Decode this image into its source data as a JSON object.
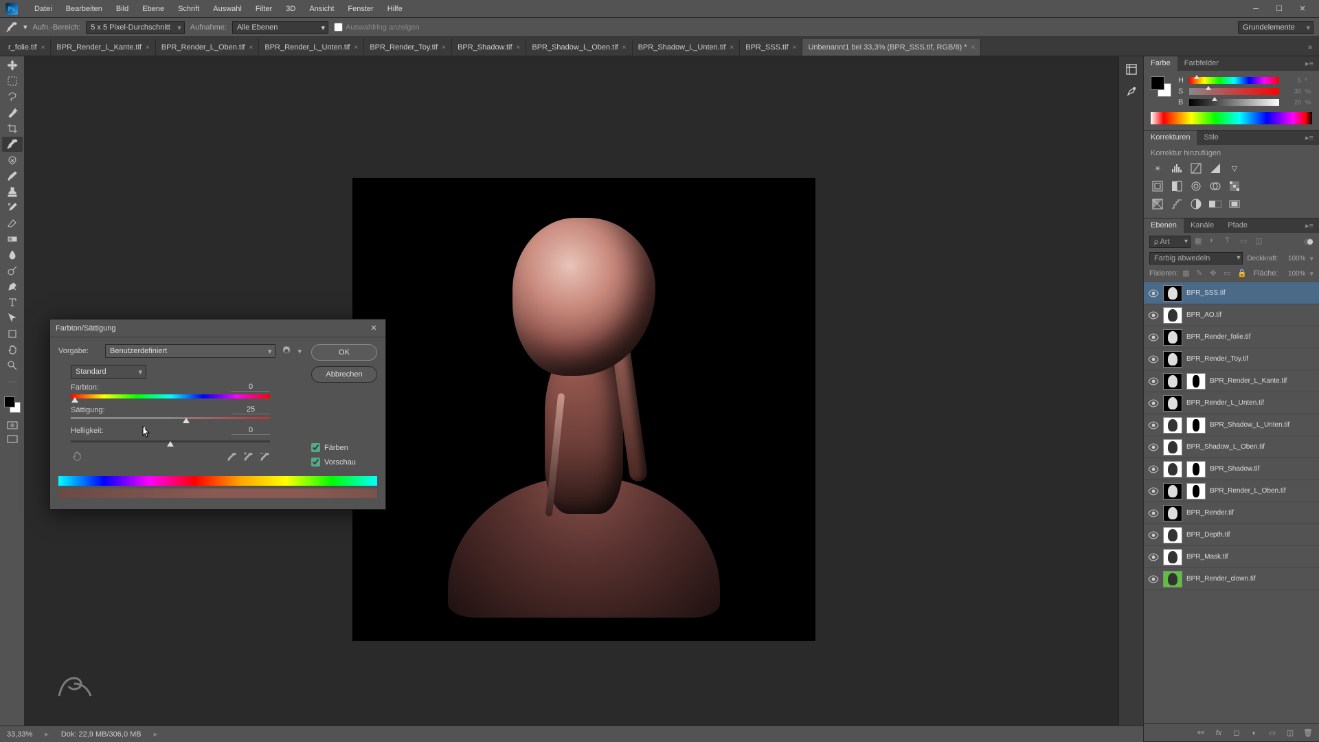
{
  "menu": [
    "Datei",
    "Bearbeiten",
    "Bild",
    "Ebene",
    "Schrift",
    "Auswahl",
    "Filter",
    "3D",
    "Ansicht",
    "Fenster",
    "Hilfe"
  ],
  "options": {
    "aufn_label": "Aufn.-Bereich:",
    "aufn_value": "5 x 5 Pixel-Durchschnitt",
    "aufnahme_label": "Aufnahme:",
    "aufnahme_value": "Alle Ebenen",
    "show_rings": "Auswahlring anzeigen",
    "right_menu": "Grundelemente"
  },
  "tabs": [
    {
      "label": "r_folie.tif"
    },
    {
      "label": "BPR_Render_L_Kante.tif"
    },
    {
      "label": "BPR_Render_L_Oben.tif"
    },
    {
      "label": "BPR_Render_L_Unten.tif"
    },
    {
      "label": "BPR_Render_Toy.tif"
    },
    {
      "label": "BPR_Shadow.tif"
    },
    {
      "label": "BPR_Shadow_L_Oben.tif"
    },
    {
      "label": "BPR_Shadow_L_Unten.tif"
    },
    {
      "label": "BPR_SSS.tif"
    },
    {
      "label": "Unbenannt1 bei 33,3% (BPR_SSS.tif, RGB/8) *",
      "active": true
    }
  ],
  "status": {
    "zoom": "33,33%",
    "doc": "Dok: 22,9 MB/306,0 MB"
  },
  "panel_color": {
    "tabs": [
      "Farbe",
      "Farbfelder"
    ],
    "rows": [
      {
        "l": "H",
        "v": "5",
        "u": "º"
      },
      {
        "l": "S",
        "v": "30",
        "u": "%"
      },
      {
        "l": "B",
        "v": "20",
        "u": "%"
      }
    ]
  },
  "panel_adj": {
    "tabs": [
      "Korrekturen",
      "Stile"
    ],
    "hint": "Korrektur hinzufügen"
  },
  "panel_layers": {
    "tabs": [
      "Ebenen",
      "Kanäle",
      "Pfade"
    ],
    "filter": "Art",
    "blend": "Farbig abwedeln",
    "opacity_label": "Deckkraft:",
    "opacity": "100%",
    "lock_label": "Fixieren:",
    "fill_label": "Fläche:",
    "fill": "100%",
    "layers": [
      {
        "name": "BPR_SSS.tif",
        "sel": true
      },
      {
        "name": "BPR_AO.tif",
        "thumb": "white"
      },
      {
        "name": "BPR_Render_folie.tif"
      },
      {
        "name": "BPR_Render_Toy.tif"
      },
      {
        "name": "BPR_Render_L_Kante.tif",
        "mask": true
      },
      {
        "name": "BPR_Render_L_Unten.tif"
      },
      {
        "name": "BPR_Shadow_L_Unten.tif",
        "mask": true,
        "thumb": "white"
      },
      {
        "name": "BPR_Shadow_L_Oben.tif",
        "mask": false,
        "thumb": "white"
      },
      {
        "name": "BPR_Shadow.tif",
        "mask": true,
        "thumb": "white"
      },
      {
        "name": "BPR_Render_L_Oben.tif",
        "mask": true
      },
      {
        "name": "BPR_Render.tif"
      },
      {
        "name": "BPR_Depth.tif",
        "thumb": "white"
      },
      {
        "name": "BPR_Mask.tif",
        "thumb": "white"
      },
      {
        "name": "BPR_Render_clown.tif",
        "thumb": "green"
      }
    ]
  },
  "dialog": {
    "title": "Farbton/Sättigung",
    "preset_label": "Vorgabe:",
    "preset": "Benutzerdefiniert",
    "channel": "Standard",
    "sliders": [
      {
        "label": "Farbton:",
        "value": "0",
        "pos": 50,
        "type": "hue"
      },
      {
        "label": "Sättigung:",
        "value": "25",
        "pos": 58,
        "type": "sat"
      },
      {
        "label": "Helligkeit:",
        "value": "0",
        "pos": 50,
        "type": "plain"
      }
    ],
    "ok": "OK",
    "cancel": "Abbrechen",
    "colorize": "Färben",
    "preview": "Vorschau"
  }
}
